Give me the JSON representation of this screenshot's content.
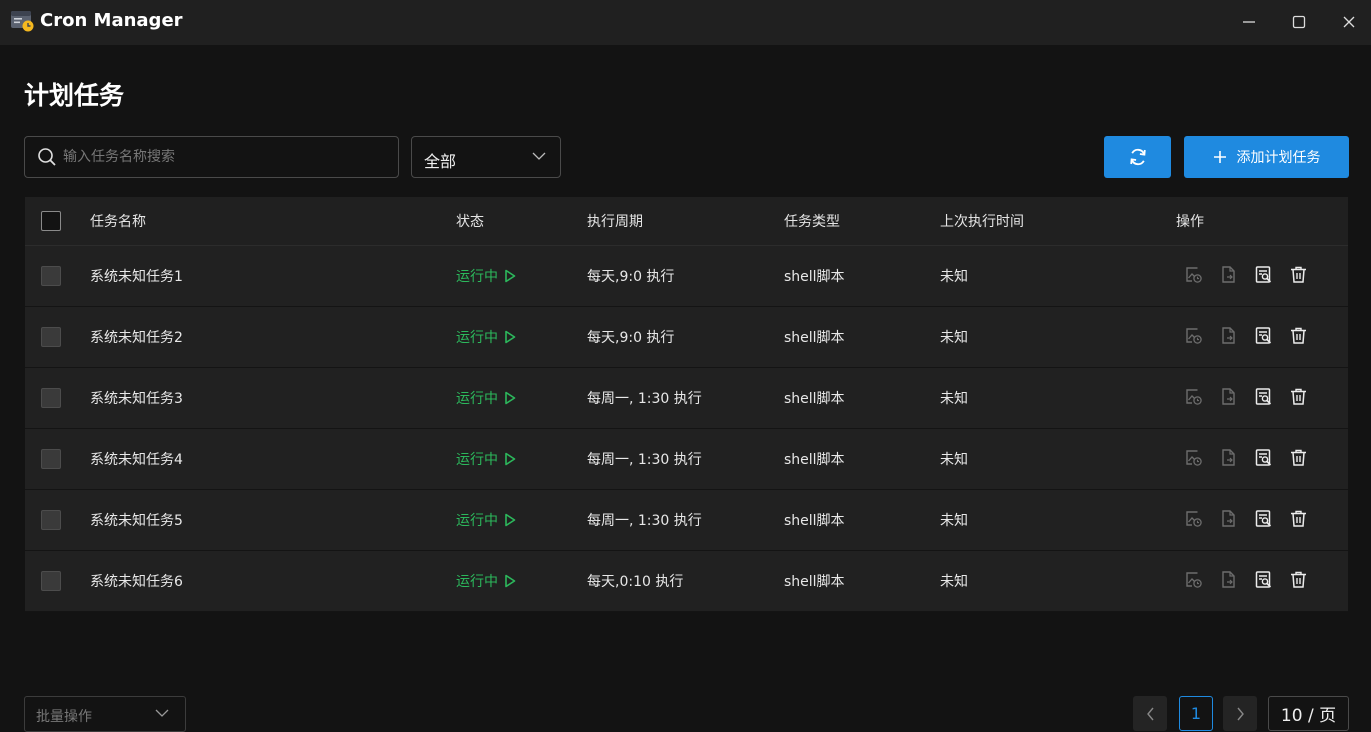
{
  "app": {
    "title": "Cron Manager"
  },
  "page": {
    "title": "计划任务"
  },
  "toolbar": {
    "search_placeholder": "输入任务名称搜索",
    "filter_value": "全部",
    "add_label": "添加计划任务"
  },
  "table": {
    "headers": [
      "任务名称",
      "状态",
      "执行周期",
      "任务类型",
      "上次执行时间",
      "操作"
    ],
    "rows": [
      {
        "name": "系统未知任务1",
        "status": "运行中",
        "cycle": "每天,9:0 执行",
        "type": "shell脚本",
        "last": "未知"
      },
      {
        "name": "系统未知任务2",
        "status": "运行中",
        "cycle": "每天,9:0 执行",
        "type": "shell脚本",
        "last": "未知"
      },
      {
        "name": "系统未知任务3",
        "status": "运行中",
        "cycle": "每周一, 1:30 执行",
        "type": "shell脚本",
        "last": "未知"
      },
      {
        "name": "系统未知任务4",
        "status": "运行中",
        "cycle": "每周一, 1:30 执行",
        "type": "shell脚本",
        "last": "未知"
      },
      {
        "name": "系统未知任务5",
        "status": "运行中",
        "cycle": "每周一, 1:30 执行",
        "type": "shell脚本",
        "last": "未知"
      },
      {
        "name": "系统未知任务6",
        "status": "运行中",
        "cycle": "每天,0:10 执行",
        "type": "shell脚本",
        "last": "未知"
      }
    ]
  },
  "footer": {
    "batch_placeholder": "批量操作",
    "current_page": "1",
    "page_size": "10 / 页"
  },
  "colors": {
    "accent": "#1f8ae0",
    "status_running": "#2cb85c",
    "background": "#131313"
  },
  "icons": {
    "app": "cron-app-icon",
    "row_actions": [
      "log-image-icon",
      "file-export-icon",
      "detail-view-icon",
      "delete-icon"
    ]
  }
}
